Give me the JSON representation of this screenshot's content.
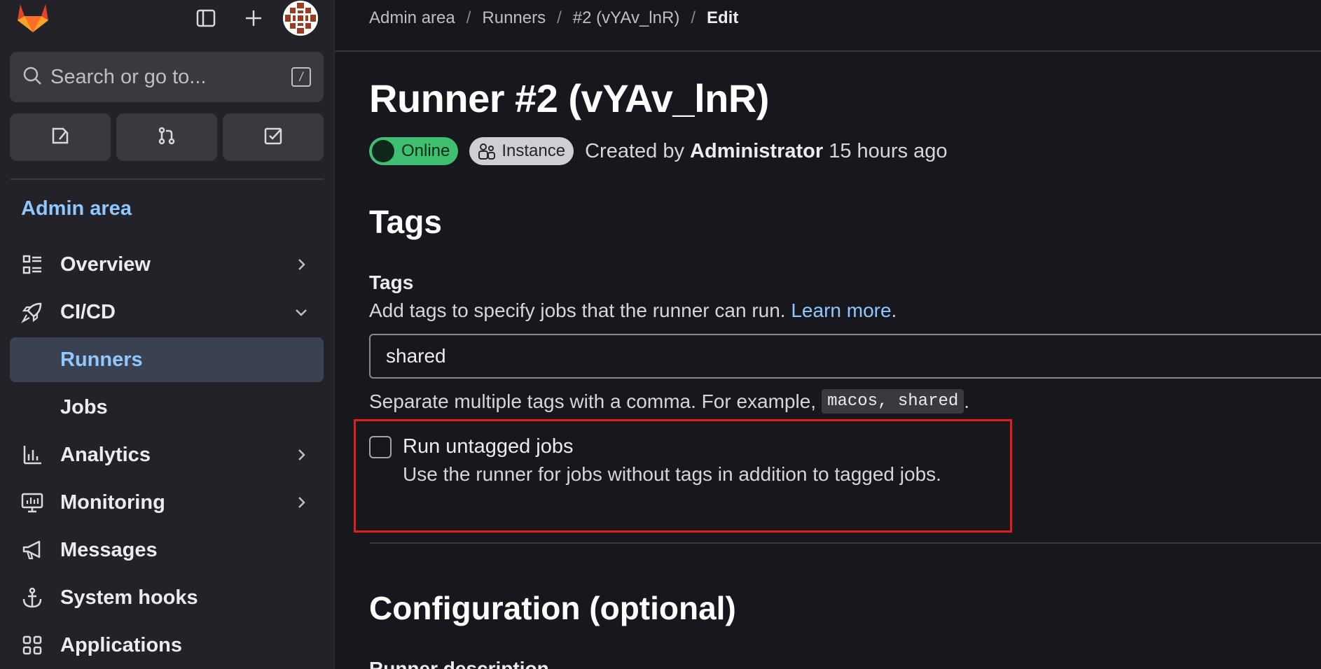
{
  "sidebar": {
    "search_placeholder": "Search or go to...",
    "search_shortcut": "/",
    "section_title": "Admin area",
    "items": [
      {
        "label": "Overview"
      },
      {
        "label": "CI/CD"
      },
      {
        "label": "Runners"
      },
      {
        "label": "Jobs"
      },
      {
        "label": "Analytics"
      },
      {
        "label": "Monitoring"
      },
      {
        "label": "Messages"
      },
      {
        "label": "System hooks"
      },
      {
        "label": "Applications"
      }
    ]
  },
  "breadcrumb": {
    "items": [
      "Admin area",
      "Runners",
      "#2 (vYAv_lnR)"
    ],
    "current": "Edit",
    "separator": "/"
  },
  "page": {
    "title": "Runner #2 (vYAv_lnR)",
    "status_badge": "Online",
    "type_badge": "Instance",
    "created_prefix": "Created by",
    "created_by": "Administrator",
    "created_when": "15 hours ago"
  },
  "tags_section": {
    "heading": "Tags",
    "field_label": "Tags",
    "description": "Add tags to specify jobs that the runner can run.",
    "learn_more": "Learn more",
    "period": ".",
    "value": "shared",
    "help_text": "Separate multiple tags with a comma. For example,",
    "help_code": "macos, shared",
    "help_end": ".",
    "untagged_label": "Run untagged jobs",
    "untagged_help": "Use the runner for jobs without tags in addition to tagged jobs.",
    "untagged_checked": false
  },
  "config_section": {
    "heading": "Configuration (optional)",
    "first_field_label": "Runner description"
  },
  "colors": {
    "background": "#18171d",
    "sidebar": "#232228",
    "accent_link": "#8fc7ff",
    "status_online": "#3fbf72",
    "highlight_box": "#dd1f1f"
  }
}
